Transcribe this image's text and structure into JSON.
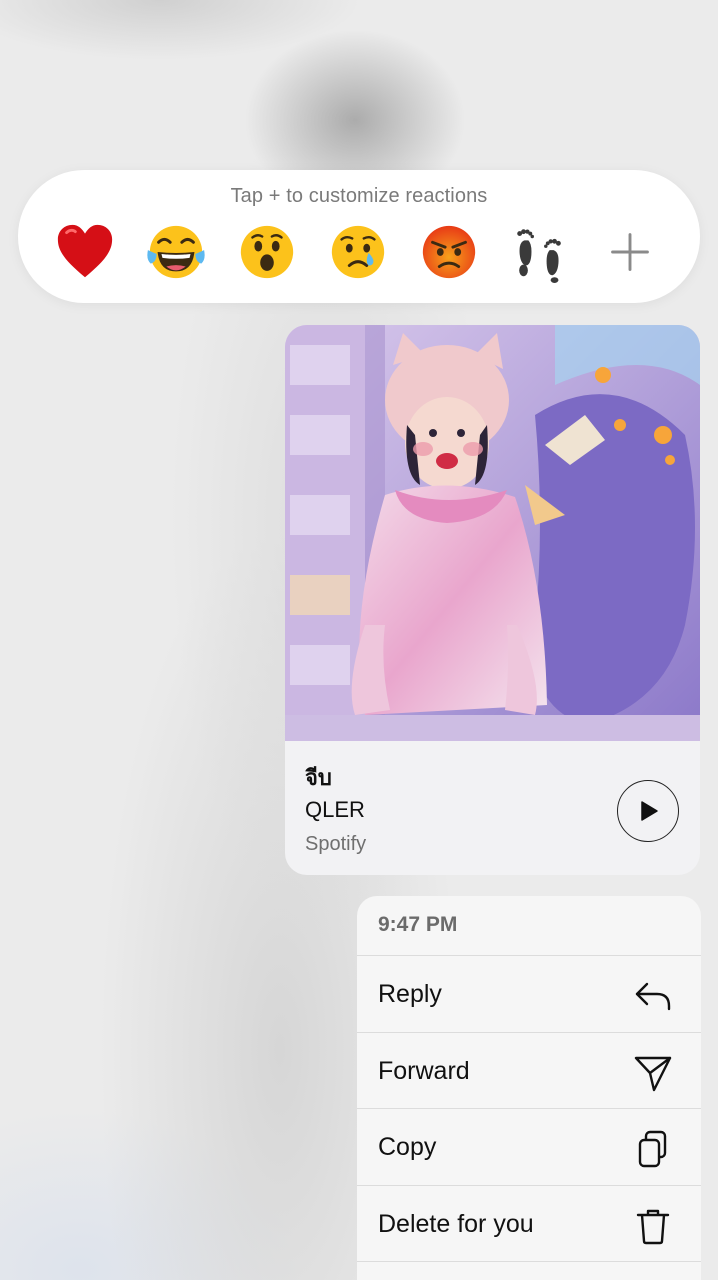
{
  "reactions": {
    "hint": "Tap + to customize reactions",
    "items": [
      {
        "name": "heart",
        "icon": "red-heart-icon"
      },
      {
        "name": "laugh",
        "icon": "tears-of-joy-icon"
      },
      {
        "name": "wow",
        "icon": "surprised-face-icon"
      },
      {
        "name": "sad",
        "icon": "crying-face-icon"
      },
      {
        "name": "angry",
        "icon": "angry-face-icon"
      },
      {
        "name": "footprints",
        "icon": "footprints-icon"
      },
      {
        "name": "more",
        "icon": "plus-icon"
      }
    ]
  },
  "music_card": {
    "title": "จีบ",
    "artist": "QLER",
    "source": "Spotify",
    "play_icon": "play-icon"
  },
  "menu": {
    "time": "9:47 PM",
    "items": [
      {
        "label": "Reply",
        "icon": "reply-arrow-icon"
      },
      {
        "label": "Forward",
        "icon": "send-icon"
      },
      {
        "label": "Copy",
        "icon": "copy-icon"
      },
      {
        "label": "Delete for you",
        "icon": "trash-icon"
      }
    ]
  },
  "colors": {
    "menu_bg": "#f6f6f6",
    "card_bg": "#f2f2f4",
    "hint_text": "#7a7a7a"
  }
}
